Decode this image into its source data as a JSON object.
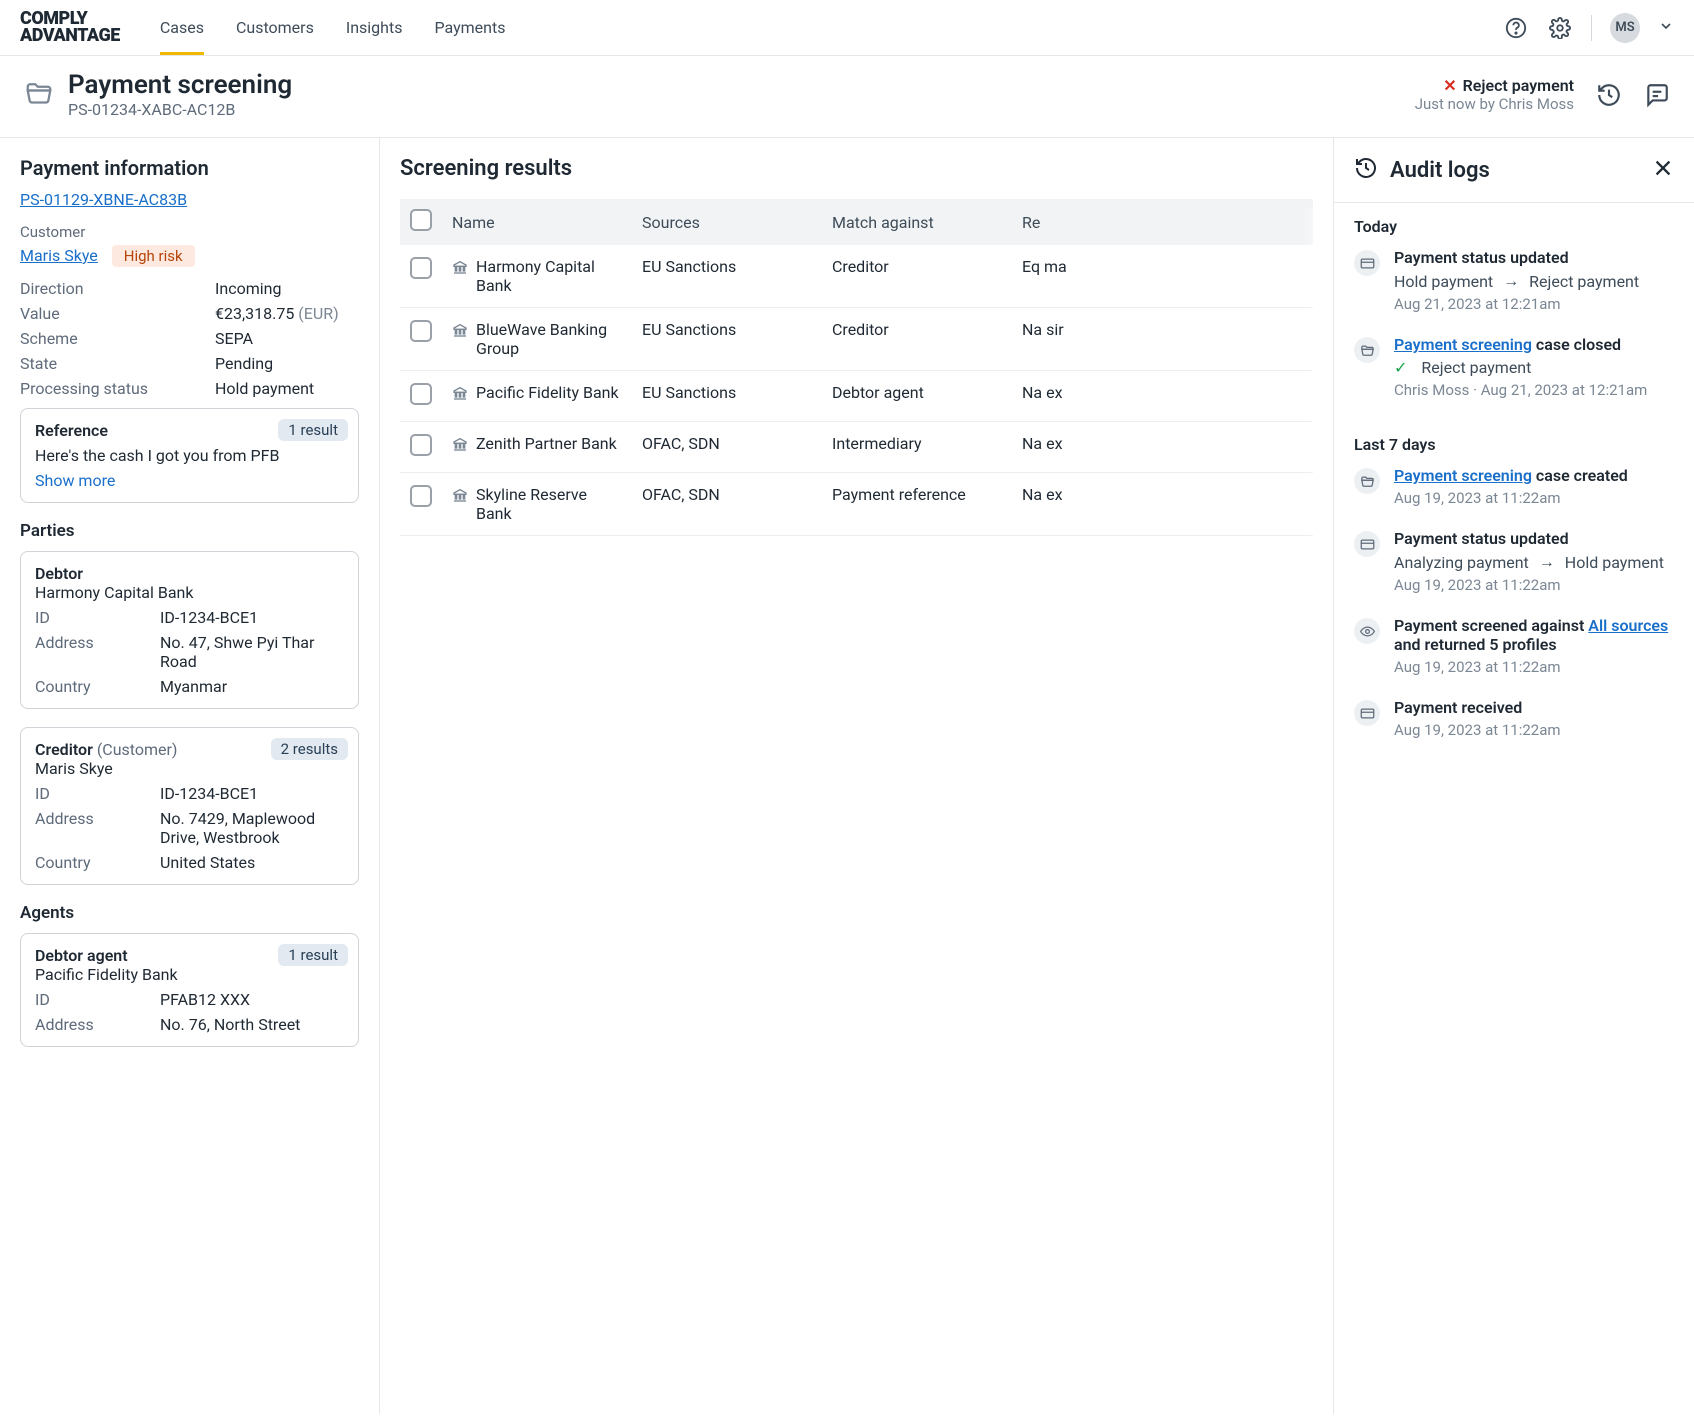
{
  "nav": {
    "logo1": "COMPLY",
    "logo2": "ADVANTAGE",
    "tabs": [
      "Cases",
      "Customers",
      "Insights",
      "Payments"
    ],
    "avatar": "MS"
  },
  "header": {
    "title": "Payment screening",
    "ref": "PS-01234-XABC-AC12B",
    "reject_label": "Reject payment",
    "reject_by": "Just now by Chris Moss"
  },
  "left": {
    "section_title": "Payment information",
    "payment_link": "PS-01129-XBNE-AC83B",
    "customer_label": "Customer",
    "customer_name": "Maris Skye",
    "risk_badge": "High risk",
    "rows": {
      "direction_k": "Direction",
      "direction_v": "Incoming",
      "value_k": "Value",
      "value_v": "€23,318.75 ",
      "value_cur": "(EUR)",
      "scheme_k": "Scheme",
      "scheme_v": "SEPA",
      "state_k": "State",
      "state_v": "Pending",
      "pstatus_k": "Processing status",
      "pstatus_v": "Hold payment"
    },
    "ref_card": {
      "title": "Reference",
      "badge": "1 result",
      "text": "Here's the cash I got you from PFB",
      "showmore": "Show more"
    },
    "parties_h": "Parties",
    "debtor": {
      "title": "Debtor",
      "name": "Harmony Capital Bank",
      "id_k": "ID",
      "id_v": "ID-1234-BCE1",
      "addr_k": "Address",
      "addr_v": "No. 47, Shwe Pyi Thar Road",
      "ctry_k": "Country",
      "ctry_v": "Myanmar"
    },
    "creditor": {
      "title": "Creditor ",
      "title_note": "(Customer)",
      "badge": "2 results",
      "name": "Maris Skye",
      "id_k": "ID",
      "id_v": "ID-1234-BCE1",
      "addr_k": "Address",
      "addr_v": "No. 7429, Maplewood Drive, Westbrook",
      "ctry_k": "Country",
      "ctry_v": "United States"
    },
    "agents_h": "Agents",
    "dagent": {
      "title": "Debtor agent",
      "badge": "1 result",
      "name": "Pacific Fidelity Bank",
      "id_k": "ID",
      "id_v": "PFAB12 XXX",
      "addr_k": "Address",
      "addr_v": "No. 76, North Street"
    }
  },
  "middle": {
    "title": "Screening results",
    "cols": {
      "c1": "Name",
      "c2": "Sources",
      "c3": "Match against",
      "c4": "Re"
    },
    "rows": [
      {
        "name": "Harmony Capital Bank",
        "sources": "EU Sanctions",
        "match": "Creditor",
        "re": "Eq ma"
      },
      {
        "name": "BlueWave Banking Group",
        "sources": "EU Sanctions",
        "match": "Creditor",
        "re": "Na sir"
      },
      {
        "name": "Pacific Fidelity Bank",
        "sources": "EU Sanctions",
        "match": "Debtor agent",
        "re": "Na ex"
      },
      {
        "name": "Zenith Partner Bank",
        "sources": "OFAC, SDN",
        "match": "Intermediary",
        "re": "Na ex"
      },
      {
        "name": "Skyline Reserve Bank",
        "sources": "OFAC, SDN",
        "match": "Payment reference",
        "re": "Na ex"
      }
    ]
  },
  "right": {
    "title": "Audit logs",
    "today": "Today",
    "last7": "Last 7 days",
    "i1": {
      "title": "Payment status updated",
      "from": "Hold payment",
      "to": "Reject payment",
      "ts": "Aug 21, 2023 at 12:21am"
    },
    "i2": {
      "link": "Payment screening",
      "suffix": " case closed",
      "outcome": "Reject payment",
      "by": "Chris Moss · Aug 21, 2023 at 12:21am"
    },
    "i3": {
      "link": "Payment screening",
      "suffix": " case created",
      "ts": "Aug 19, 2023 at 11:22am"
    },
    "i4": {
      "title": "Payment status updated",
      "from": "Analyzing payment",
      "to": "Hold payment",
      "ts": "Aug 19, 2023 at 11:22am"
    },
    "i5": {
      "pre": "Payment screened against ",
      "link": "All sources",
      "post": " and returned 5 profiles",
      "ts": "Aug 19, 2023 at 11:22am"
    },
    "i6": {
      "title": "Payment received",
      "ts": "Aug 19, 2023 at 11:22am"
    }
  }
}
